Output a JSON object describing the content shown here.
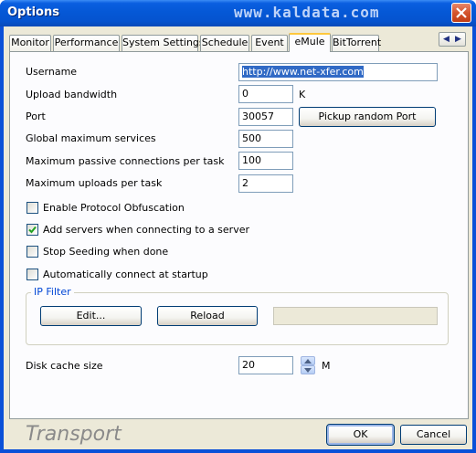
{
  "window": {
    "title": "Options",
    "watermark": "www.kaldata.com",
    "colors": {
      "titlebar": "#0558d6",
      "face": "#ece9d8",
      "accent_tab": "#ffc83c",
      "group_title": "#0046d5"
    }
  },
  "tabs": [
    {
      "label": "Monitor",
      "active": false
    },
    {
      "label": "Performance",
      "active": false
    },
    {
      "label": "System Settings",
      "active": false
    },
    {
      "label": "Schedule",
      "active": false
    },
    {
      "label": "Event",
      "active": false
    },
    {
      "label": "eMule",
      "active": true
    },
    {
      "label": "BitTorrent",
      "active": false
    }
  ],
  "form": {
    "username": {
      "label": "Username",
      "value": "http://www.net-xfer.com"
    },
    "upload_bandwidth": {
      "label": "Upload bandwidth",
      "value": "0",
      "unit": "K"
    },
    "port": {
      "label": "Port",
      "value": "30057",
      "button": "Pickup random Port"
    },
    "global_max_services": {
      "label": "Global maximum services",
      "value": "500"
    },
    "max_passive": {
      "label": "Maximum passive connections per task",
      "value": "100"
    },
    "max_uploads": {
      "label": "Maximum uploads per task",
      "value": "2"
    }
  },
  "checkboxes": [
    {
      "label": "Enable Protocol Obfuscation",
      "checked": false
    },
    {
      "label": "Add servers when connecting to a server",
      "checked": true
    },
    {
      "label": "Stop Seeding when done",
      "checked": false
    },
    {
      "label": "Automatically connect at startup",
      "checked": false
    }
  ],
  "ip_filter": {
    "title": "IP Filter",
    "edit_button": "Edit...",
    "reload_button": "Reload",
    "status_value": ""
  },
  "disk_cache": {
    "label": "Disk cache size",
    "value": "20",
    "unit": "M"
  },
  "footer": {
    "brand": "Transport",
    "ok_button": "OK",
    "cancel_button": "Cancel"
  },
  "icons": {
    "close": "close-icon",
    "tab_scroll_left": "chevron-left-icon",
    "tab_scroll_right": "chevron-right-icon",
    "spin_up": "chevron-up-icon",
    "spin_down": "chevron-down-icon",
    "check": "check-icon"
  }
}
